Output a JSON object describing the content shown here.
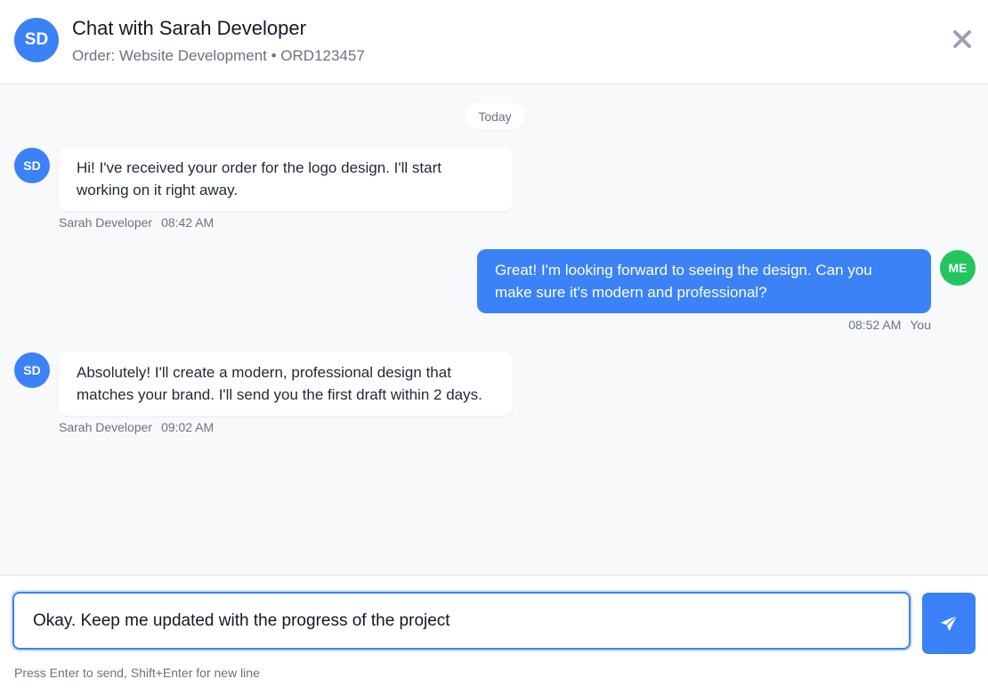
{
  "header": {
    "avatar_initials": "SD",
    "title": "Chat with Sarah Developer",
    "subtitle": "Order: Website Development • ORD123457",
    "close_icon": "close-icon"
  },
  "messages": {
    "date_label": "Today",
    "items": [
      {
        "direction": "incoming",
        "avatar": "SD",
        "text": "Hi! I've received your order for the logo design. I'll start working on it right away.",
        "sender": "Sarah Developer",
        "time": "08:42 AM"
      },
      {
        "direction": "outgoing",
        "avatar": "ME",
        "text": "Great! I'm looking forward to seeing the design. Can you make sure it's modern and professional?",
        "sender": "You",
        "time": "08:52 AM"
      },
      {
        "direction": "incoming",
        "avatar": "SD",
        "text": "Absolutely! I'll create a modern, professional design that matches your brand. I'll send you the first draft within 2 days.",
        "sender": "Sarah Developer",
        "time": "09:02 AM"
      }
    ]
  },
  "composer": {
    "input_value": "Okay. Keep me updated with the progress of the project",
    "send_icon": "send-icon",
    "hint": "Press Enter to send, Shift+Enter for new line"
  },
  "colors": {
    "accent": "#3b82f6",
    "me_avatar": "#22c55e",
    "background": "#f8f9fb"
  }
}
